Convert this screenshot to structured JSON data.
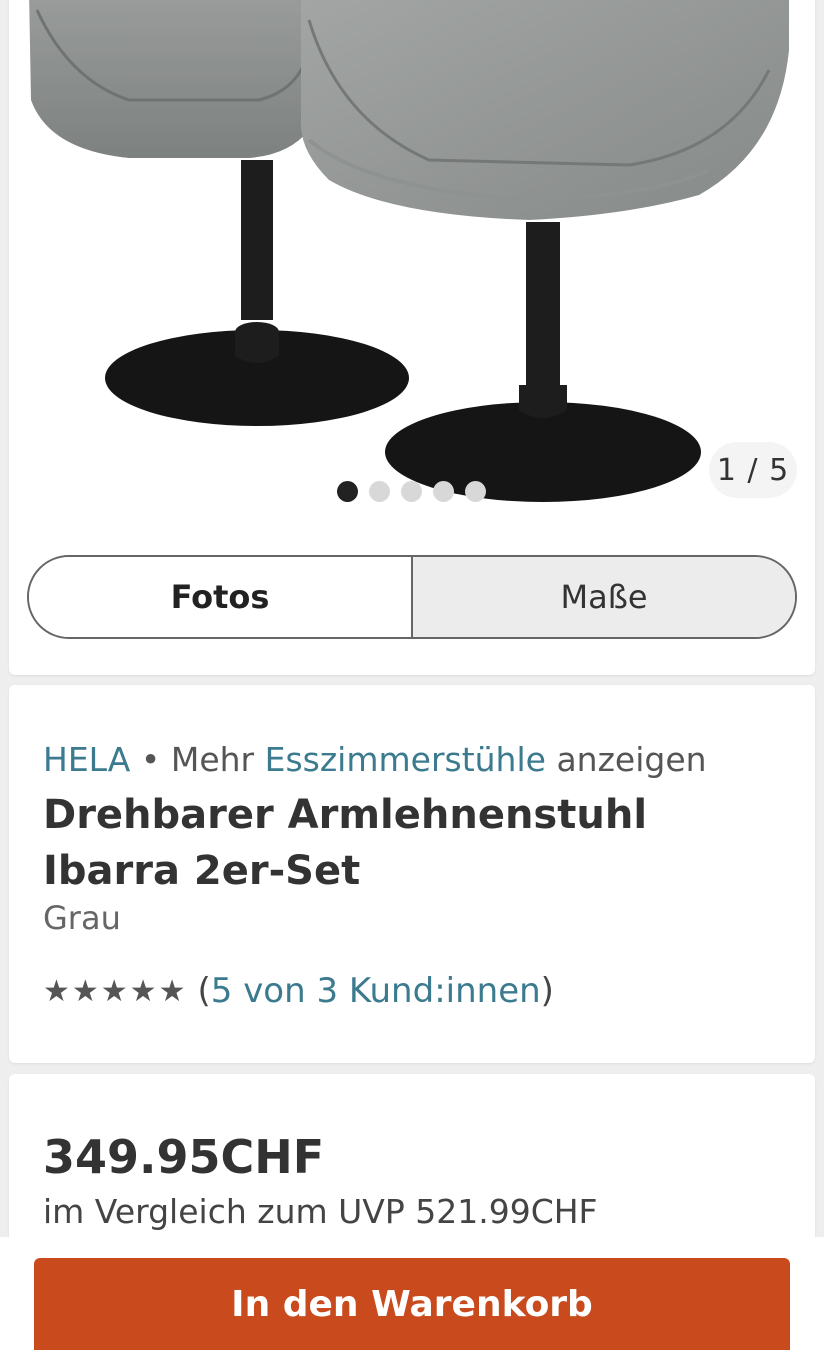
{
  "gallery": {
    "counter": "1 / 5",
    "total_images": 5,
    "active_index": 1,
    "tabs": [
      {
        "label": "Fotos",
        "active": true
      },
      {
        "label": "Maße",
        "active": false
      }
    ]
  },
  "product": {
    "brand": "HELA",
    "more_prefix": "Mehr",
    "category_link": "Esszimmerstühle",
    "more_suffix": "anzeigen",
    "title": "Drehbarer Armlehnenstuhl Ibarra 2er-Set",
    "color": "Grau",
    "rating_stars": 5,
    "rating_open": "(",
    "rating_text": "5 von 3 Kund:innen",
    "rating_close": ")"
  },
  "pricing": {
    "price": "349.95CHF",
    "uvp_text": "im Vergleich zum UVP 521.99CHF"
  },
  "cart": {
    "button_label": "In den Warenkorb"
  },
  "colors": {
    "accent": "#c94a1c",
    "link": "#3b7a8f"
  }
}
